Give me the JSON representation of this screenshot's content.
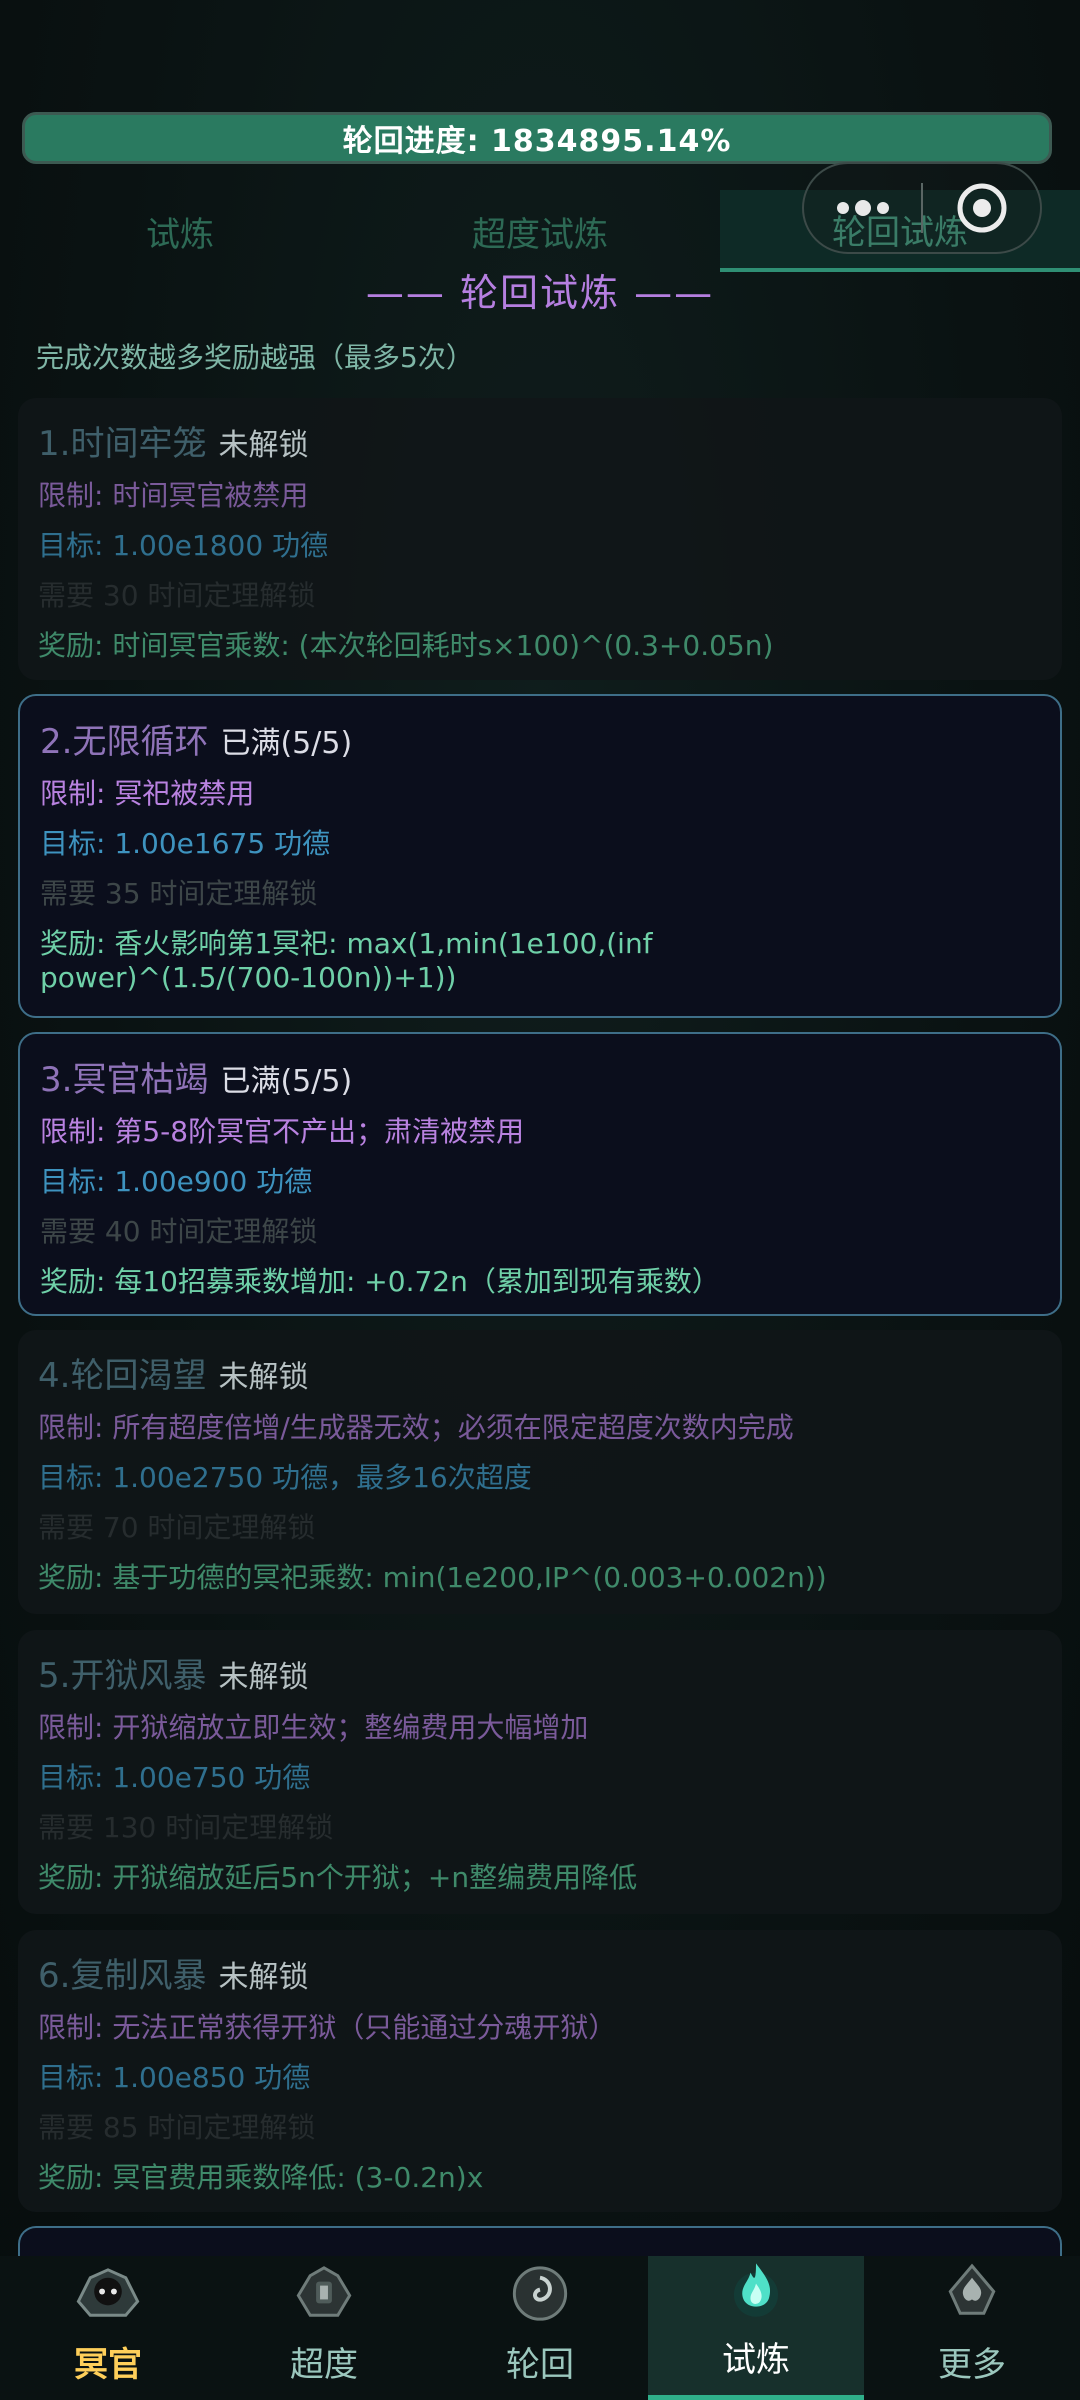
{
  "progress": {
    "label": "轮回进度: 1834895.14%",
    "value_percent": 1834895.14
  },
  "tabs": [
    {
      "label": "试炼",
      "active": false
    },
    {
      "label": "超度试炼",
      "active": false
    },
    {
      "label": "轮回试炼",
      "active": true
    }
  ],
  "heading": "—— 轮回试炼 ——",
  "subtitle": "完成次数越多奖励越强（最多5次）",
  "challenges": [
    {
      "title": "1.时间牢笼",
      "state": "未解锁",
      "limit": "限制: 时间冥官被禁用",
      "goal": "目标: 1.00e1800 功德",
      "need": "需要 30 时间定理解锁",
      "reward": "奖励: 时间冥官乘数: (本次轮回耗时s×100)^(0.3+0.05n)",
      "completed": false
    },
    {
      "title": "2.无限循环",
      "state": "已满(5/5)",
      "limit": "限制: 冥祀被禁用",
      "goal": "目标: 1.00e1675 功德",
      "need": "需要 35 时间定理解锁",
      "reward": "奖励: 香火影响第1冥祀: max(1,min(1e100,(inf power)^(1.5/(700-100n))+1))",
      "completed": true
    },
    {
      "title": "3.冥官枯竭",
      "state": "已满(5/5)",
      "limit": "限制: 第5-8阶冥官不产出；肃清被禁用",
      "goal": "目标: 1.00e900 功德",
      "need": "需要 40 时间定理解锁",
      "reward": "奖励: 每10招募乘数增加: +0.72n（累加到现有乘数）",
      "completed": true
    },
    {
      "title": "4.轮回渴望",
      "state": "未解锁",
      "limit": "限制: 所有超度倍增/生成器无效；必须在限定超度次数内完成",
      "goal": "目标: 1.00e2750 功德，最多16次超度",
      "need": "需要 70 时间定理解锁",
      "reward": "奖励: 基于功德的冥祀乘数: min(1e200,IP^(0.003+0.002n))",
      "completed": false
    },
    {
      "title": "5.开狱风暴",
      "state": "未解锁",
      "limit": "限制: 开狱缩放立即生效；整编费用大幅增加",
      "goal": "目标: 1.00e750 功德",
      "need": "需要 130 时间定理解锁",
      "reward": "奖励: 开狱缩放延后5n个开狱；+n整编费用降低",
      "completed": false
    },
    {
      "title": "6.复制风暴",
      "state": "未解锁",
      "limit": "限制: 无法正常获得开狱（只能通过分魂开狱）",
      "goal": "目标: 1.00e850 功德",
      "need": "需要 85 时间定理解锁",
      "reward": "奖励: 冥官费用乘数降低: (3-0.2n)x",
      "completed": false
    }
  ],
  "nav": [
    {
      "label": "冥官",
      "icon": "skull-crest-icon",
      "active": false
    },
    {
      "label": "超度",
      "icon": "lantern-crest-icon",
      "active": false
    },
    {
      "label": "轮回",
      "icon": "swirl-crest-icon",
      "active": false
    },
    {
      "label": "试炼",
      "icon": "flame-crest-icon",
      "active": true
    },
    {
      "label": "更多",
      "icon": "spade-crest-icon",
      "active": false
    }
  ],
  "colors": {
    "accent": "#2f8f74",
    "progress_fill": "#2a7a60",
    "heading": "#b57fe0",
    "completed_border": "#3e6e88"
  }
}
